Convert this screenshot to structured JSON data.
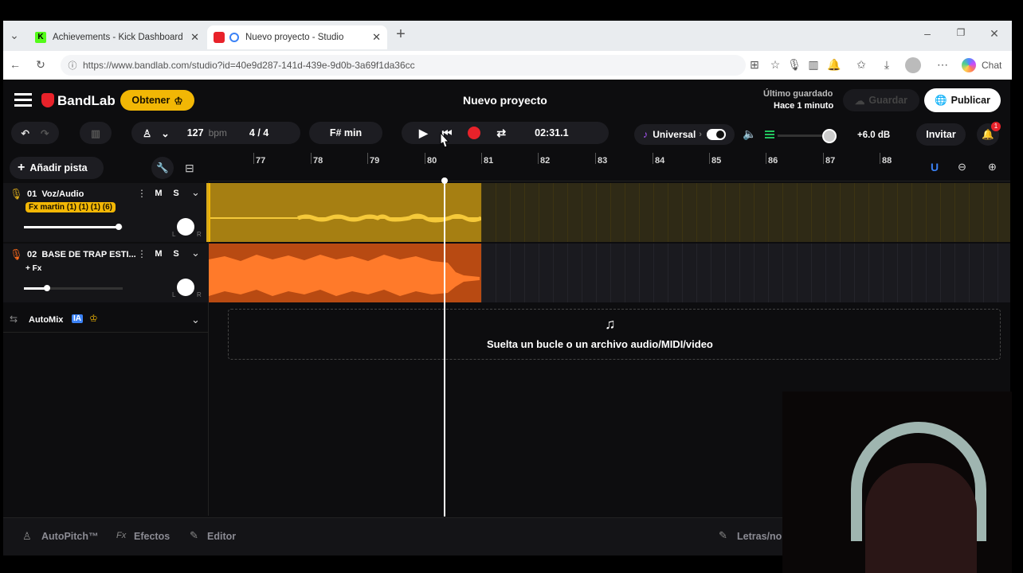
{
  "browser": {
    "tabs": [
      {
        "title": "Achievements - Kick Dashboard",
        "close": "✕"
      },
      {
        "title": "Nuevo proyecto - Studio",
        "close": "✕"
      }
    ],
    "new_tab": "+",
    "url": "https://www.bandlab.com/studio?id=40e9d287-141d-439e-9d0b-3a69f1da36cc",
    "chat_label": "Chat"
  },
  "header": {
    "brand": "BandLab",
    "obtener": "Obtener",
    "title": "Nuevo proyecto",
    "last_saved_label": "Último guardado",
    "last_saved_time": "Hace 1 minuto",
    "save": "Guardar",
    "publish": "Publicar"
  },
  "toolbar": {
    "bpm_value": "127",
    "bpm_unit": "bpm",
    "time_signature": "4 / 4",
    "key": "F# min",
    "time": "02:31.1",
    "universal": "Universal",
    "db": "+6.0 dB",
    "invite": "Invitar",
    "notification_count": "1"
  },
  "tracks_header": {
    "add_track": "Añadir pista"
  },
  "ruler": [
    "77",
    "78",
    "79",
    "80",
    "81",
    "82",
    "83",
    "84",
    "85",
    "86",
    "87",
    "88"
  ],
  "tracks": [
    {
      "name": "01  Voz/Audio",
      "fx": "Fx martin (1) (1) (1) (6)",
      "mute": "M",
      "solo": "S",
      "color": "#d9a91a",
      "volume": 0.85,
      "pan_l": "L",
      "pan_r": "R"
    },
    {
      "name": "02  BASE DE TRAP ESTI...",
      "fx": "+ Fx",
      "mute": "M",
      "solo": "S",
      "color": "#ff6b1a",
      "volume": 0.2,
      "pan_l": "L",
      "pan_r": "R"
    }
  ],
  "automix": {
    "label": "AutoMix",
    "badge": "IA"
  },
  "dropzone": {
    "text": "Suelta un bucle o un archivo audio/MIDI/video"
  },
  "footer": {
    "autopitch": "AutoPitch™",
    "effects": "Efectos",
    "editor": "Editor",
    "lyrics": "Letras/no"
  },
  "colors": {
    "accent": "#f2b705",
    "record": "#e8222a",
    "track1": "#d9a91a",
    "track2": "#ff6b1a"
  }
}
